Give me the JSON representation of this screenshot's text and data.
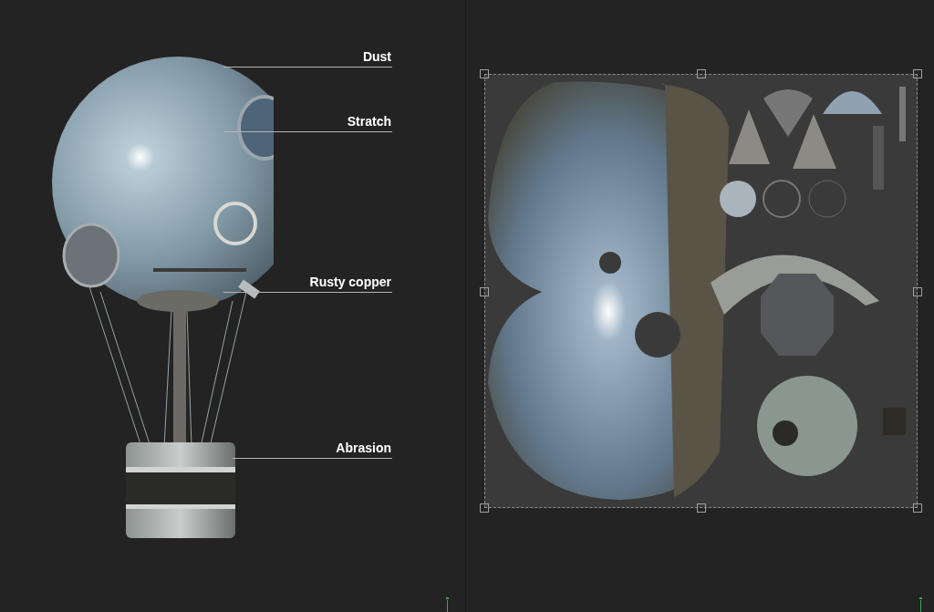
{
  "callouts": [
    {
      "label": "Dust"
    },
    {
      "label": "Stratch"
    },
    {
      "label": "Rusty copper"
    },
    {
      "label": "Abrasion"
    }
  ]
}
